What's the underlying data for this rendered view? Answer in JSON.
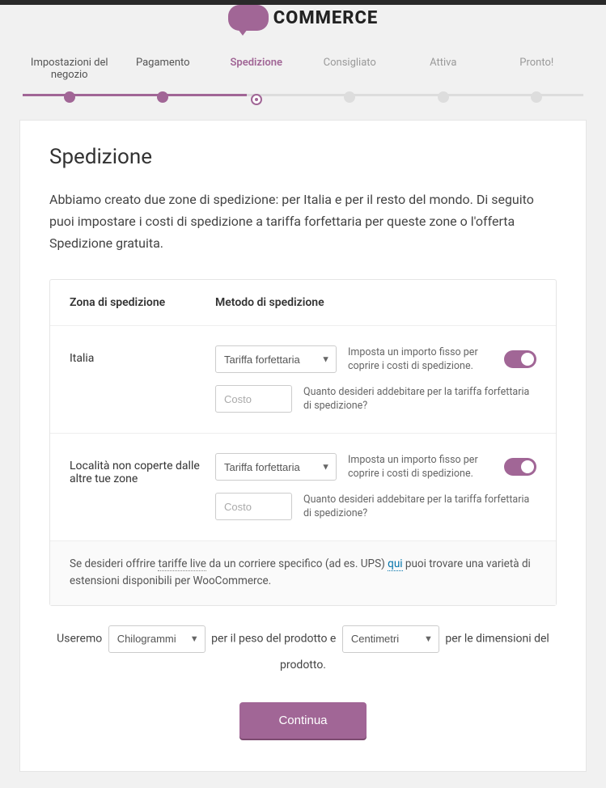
{
  "logo_text": "COMMERCE",
  "steps": [
    {
      "label": "Impostazioni del negozio",
      "state": "done"
    },
    {
      "label": "Pagamento",
      "state": "done"
    },
    {
      "label": "Spedizione",
      "state": "active"
    },
    {
      "label": "Consigliato",
      "state": "future"
    },
    {
      "label": "Attiva",
      "state": "future"
    },
    {
      "label": "Pronto!",
      "state": "future"
    }
  ],
  "page_title": "Spedizione",
  "intro": "Abbiamo creato due zone di spedizione: per Italia e per il resto del mondo. Di seguito puoi impostare i costi di spedizione a tariffa forfettaria per queste zone o l'offerta Spedizione gratuita.",
  "table": {
    "header_zone": "Zona di spedizione",
    "header_method": "Metodo di spedizione"
  },
  "zones": [
    {
      "name": "Italia",
      "method_selected": "Tariffa forfettaria",
      "method_desc": "Imposta un importo fisso per coprire i costi di spedizione.",
      "cost_placeholder": "Costo",
      "cost_value": "",
      "cost_desc": "Quanto desideri addebitare per la tariffa forfettaria di spedizione?",
      "toggle_on": true
    },
    {
      "name": "Località non coperte dalle altre tue zone",
      "method_selected": "Tariffa forfettaria",
      "method_desc": "Imposta un importo fisso per coprire i costi di spedizione.",
      "cost_placeholder": "Costo",
      "cost_value": "",
      "cost_desc": "Quanto desideri addebitare per la tariffa forfettaria di spedizione?",
      "toggle_on": true
    }
  ],
  "footer_note": {
    "pre": "Se desideri offrire ",
    "dotted": "tariffe live",
    "mid": " da un corriere specifico (ad es. UPS) ",
    "link": "qui",
    "post": " puoi trovare una varietà di estensioni disponibili per WooCommerce."
  },
  "units": {
    "pre": "Useremo",
    "weight_selected": "Chilogrammi",
    "mid": "per il peso del prodotto e",
    "dim_selected": "Centimetri",
    "post": "per le dimensioni del prodotto."
  },
  "continue_label": "Continua"
}
